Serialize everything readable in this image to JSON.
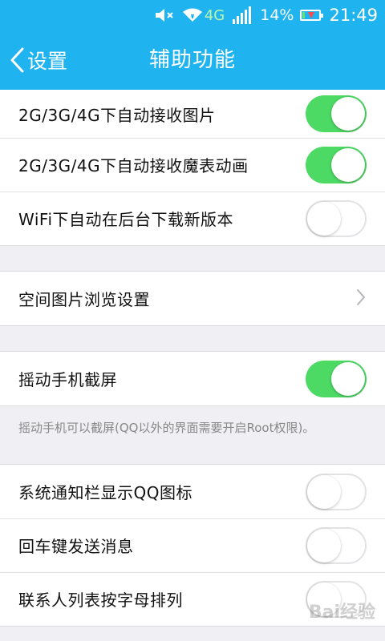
{
  "status_bar": {
    "network": "4G",
    "battery": "14%",
    "battery_level": 0.14,
    "time": "21:49"
  },
  "header": {
    "back_label": "设置",
    "title": "辅助功能"
  },
  "settings": {
    "auto_image": {
      "label": "2G/3G/4G下自动接收图片",
      "on": true
    },
    "auto_magic": {
      "label": "2G/3G/4G下自动接收魔表动画",
      "on": true
    },
    "wifi_update": {
      "label": "WiFi下自动在后台下载新版本",
      "on": false
    },
    "space_browse": {
      "label": "空间图片浏览设置"
    },
    "shake_screenshot": {
      "label": "摇动手机截屏",
      "on": true
    },
    "shake_note": "摇动手机可以截屏(QQ以外的界面需要开启Root权限)。",
    "notify_icon": {
      "label": "系统通知栏显示QQ图标",
      "on": false
    },
    "enter_send": {
      "label": "回车键发送消息",
      "on": false
    },
    "contacts_sort": {
      "label": "联系人列表按字母排列",
      "on": false
    }
  },
  "watermark": "Bai经验",
  "colors": {
    "accent": "#1fb4ef",
    "toggle_on": "#4cd964"
  }
}
